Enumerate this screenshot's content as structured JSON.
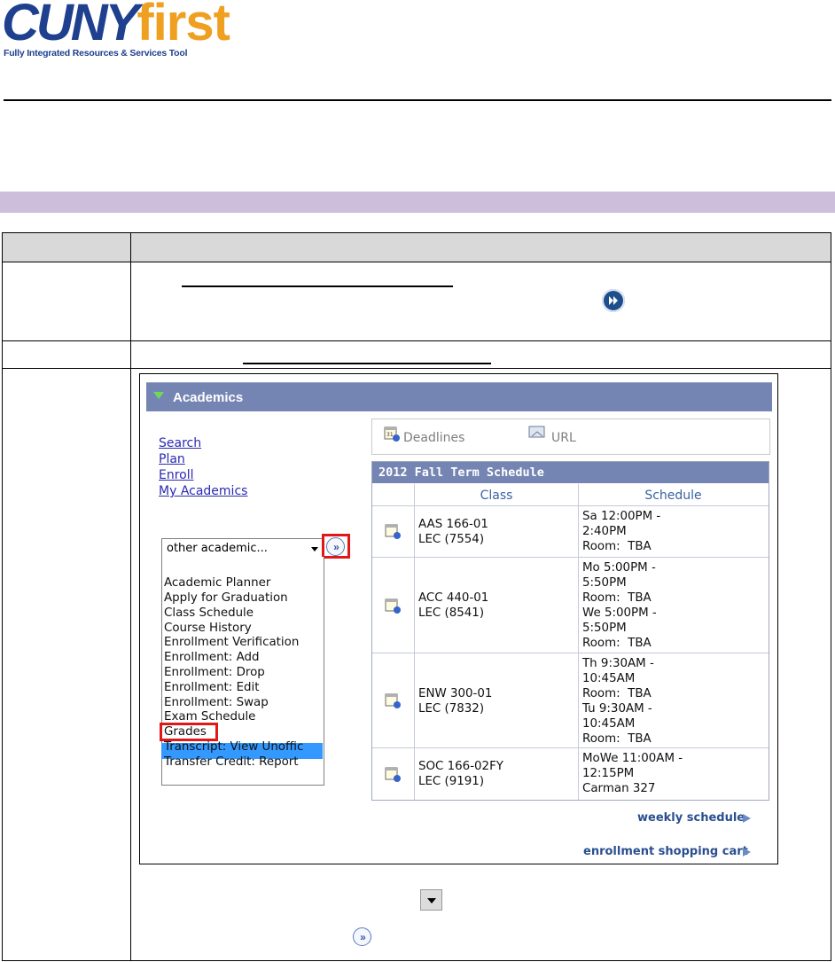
{
  "logo": {
    "word_a": "CUNY",
    "word_b": "first",
    "tagline": "Fully Integrated Resources & Services Tool"
  },
  "colors": {
    "brand_blue": "#1f3f8f",
    "brand_orange": "#f0a020",
    "band": "#cdbfdb",
    "header_bar": "#7585b3",
    "highlight": "#e01818",
    "selected": "#3399ff"
  },
  "portal": {
    "panel_title": "Academics",
    "links": [
      "Search",
      "Plan",
      "Enroll",
      "My Academics"
    ],
    "select_value": "other academic...",
    "options": [
      "Academic Planner",
      "Apply for Graduation",
      "Class Schedule",
      "Course History",
      "Enrollment Verification",
      "Enrollment: Add",
      "Enrollment: Drop",
      "Enrollment: Edit",
      "Enrollment: Swap",
      "Exam Schedule",
      "Grades",
      "Transcript: View Unoffic",
      "Transfer Credit: Report",
      "other academic..."
    ],
    "deadlines_label": "Deadlines",
    "url_label": "URL",
    "schedule_title": "2012 Fall Term Schedule",
    "col_class": "Class",
    "col_schedule": "Schedule",
    "rows": [
      {
        "class": "AAS 166-01\nLEC (7554)",
        "schedule": "Sa 12:00PM -\n2:40PM\nRoom:  TBA"
      },
      {
        "class": "ACC 440-01\nLEC (8541)",
        "schedule": "Mo 5:00PM -\n5:50PM\nRoom:  TBA\nWe 5:00PM -\n5:50PM\nRoom:  TBA"
      },
      {
        "class": "ENW 300-01\nLEC (7832)",
        "schedule": "Th 9:30AM -\n10:45AM\nRoom:  TBA\nTu 9:30AM -\n10:45AM\nRoom:  TBA"
      },
      {
        "class": "SOC 166-02FY\nLEC (9191)",
        "schedule": "MoWe 11:00AM -\n12:15PM\nCarman 327"
      }
    ],
    "weekly_link": "weekly schedule",
    "cart_link": "enrollment shopping cart"
  }
}
